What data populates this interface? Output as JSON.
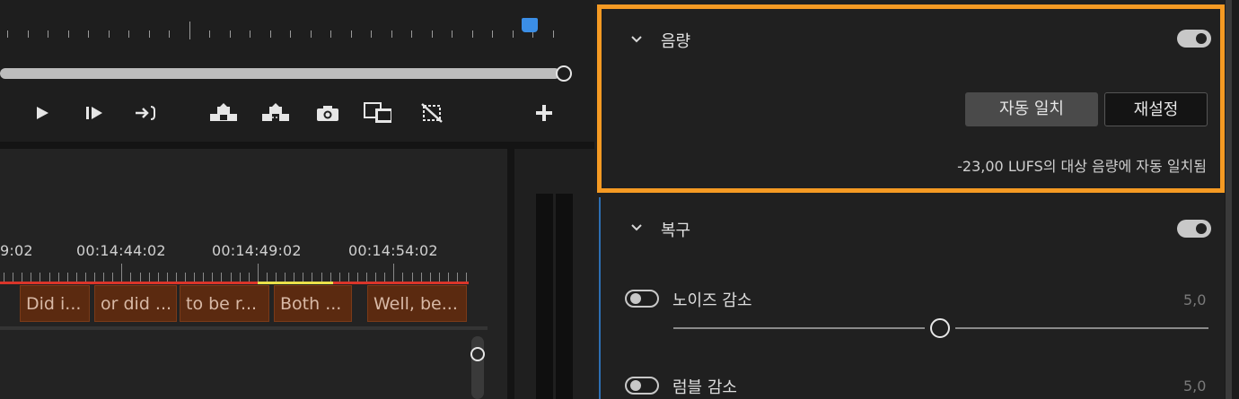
{
  "timeline": {
    "timecodes": [
      "9:02",
      "00:14:44:02",
      "00:14:49:02",
      "00:14:54:02"
    ],
    "captions": [
      "Did i...",
      "or did ...",
      "to be r...",
      "Both ...",
      "Well, be..."
    ]
  },
  "transport": {
    "icons": [
      "step-back-icon",
      "play-icon",
      "step-forward-icon",
      "go-to-out-icon",
      "lift-icon",
      "extract-icon",
      "camera-icon",
      "comparison-view-icon",
      "vr-mode-icon",
      "add-button-icon"
    ]
  },
  "volume": {
    "title": "음량",
    "auto_match_label": "자동 일치",
    "reset_label": "재설정",
    "status": "-23,00 LUFS의 대상 음량에 자동 일치됨",
    "enabled": true
  },
  "repair": {
    "title": "복구",
    "enabled": true,
    "noise_reduction": {
      "label": "노이즈 감소",
      "value": "5,0",
      "enabled": false,
      "level": 0.5
    },
    "rumble_reduction": {
      "label": "럼블 감소",
      "value": "5,0",
      "enabled": false
    }
  },
  "colors": {
    "highlight": "#f59a23",
    "playhead": "#3b8ee6",
    "caption_bg": "#5b2a10",
    "in_out_red": "#d9352a",
    "work_area_yellow": "#e8e04a"
  }
}
